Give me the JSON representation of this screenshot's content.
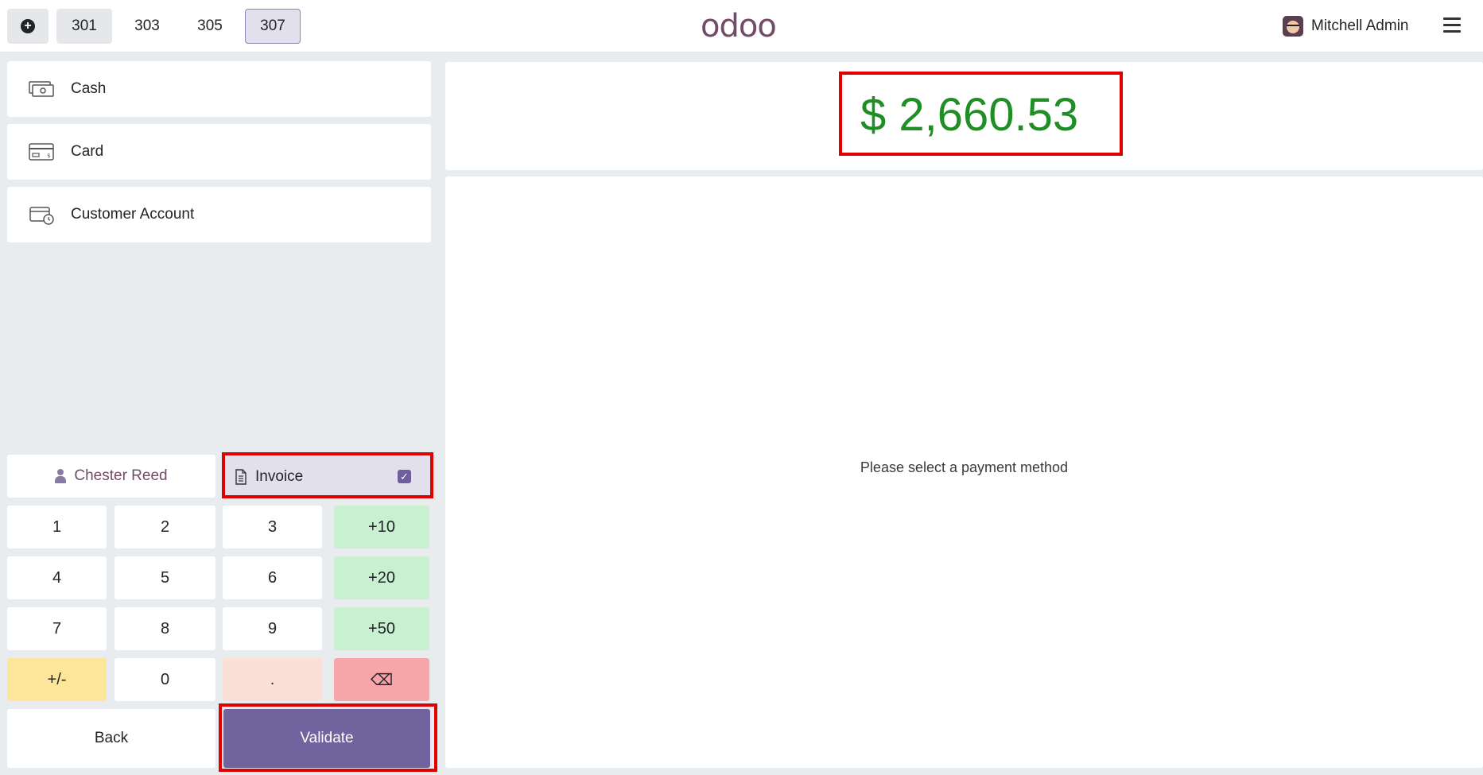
{
  "header": {
    "order_tabs": [
      {
        "label": "301",
        "state": "light"
      },
      {
        "label": "303",
        "state": "plain"
      },
      {
        "label": "305",
        "state": "plain"
      },
      {
        "label": "307",
        "state": "active"
      }
    ],
    "logo_text": "odoo",
    "user_name": "Mitchell Admin"
  },
  "payment_methods": [
    {
      "label": "Cash",
      "icon": "cash-icon"
    },
    {
      "label": "Card",
      "icon": "card-icon"
    },
    {
      "label": "Customer Account",
      "icon": "customer-account-icon"
    }
  ],
  "customer": {
    "label": "Chester Reed"
  },
  "invoice": {
    "label": "Invoice",
    "checked": true
  },
  "numpad": {
    "keys": [
      "1",
      "2",
      "3",
      "+10",
      "4",
      "5",
      "6",
      "+20",
      "7",
      "8",
      "9",
      "+50",
      "+/-",
      "0",
      ".",
      "⌫"
    ]
  },
  "actions": {
    "back_label": "Back",
    "validate_label": "Validate"
  },
  "payment": {
    "total": "$ 2,660.53",
    "status_message": "Please select a payment method"
  },
  "colors": {
    "brand": "#714b67",
    "validate": "#71639e",
    "total_text": "#1f8f25",
    "highlight": "#e10000"
  }
}
